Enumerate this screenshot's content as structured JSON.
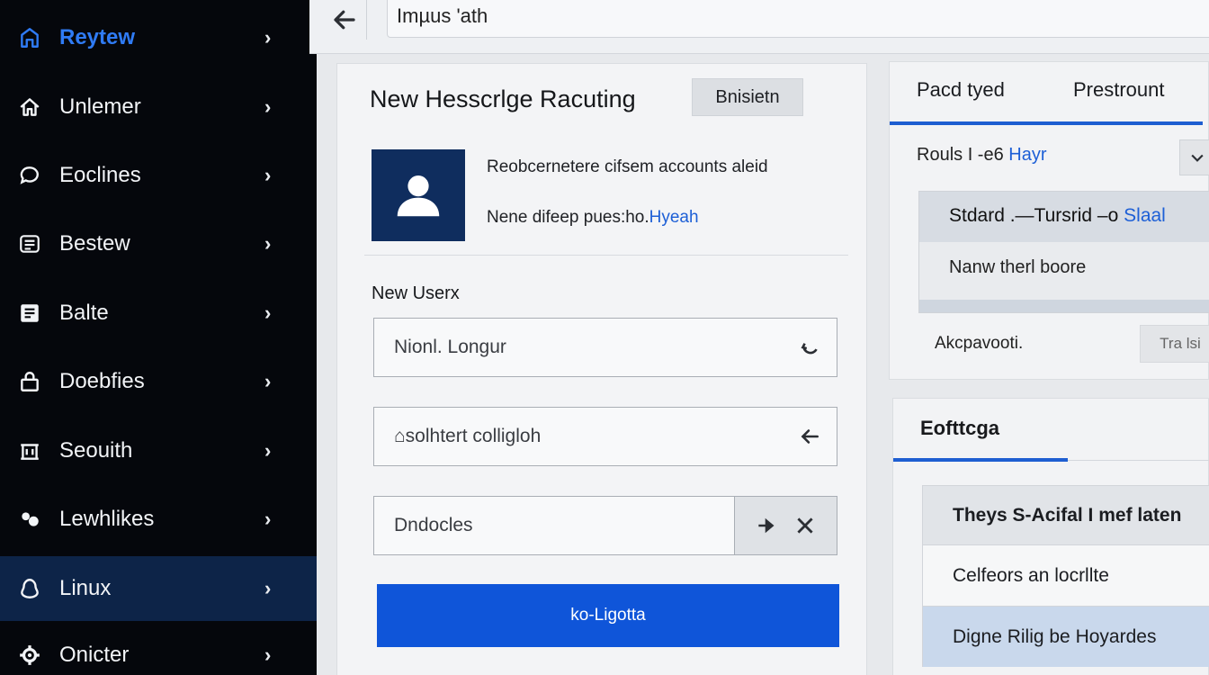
{
  "sidebar": {
    "items": [
      {
        "label": "Reytew",
        "icon": "home-outline-icon"
      },
      {
        "label": "Unlemer",
        "icon": "house-icon"
      },
      {
        "label": "Eoclines",
        "icon": "chat-bubble-icon"
      },
      {
        "label": "Bestew",
        "icon": "list-icon"
      },
      {
        "label": "Balte",
        "icon": "document-icon"
      },
      {
        "label": "Doebfies",
        "icon": "lock-icon"
      },
      {
        "label": "Seouith",
        "icon": "building-icon"
      },
      {
        "label": "Lewhlikes",
        "icon": "group-icon"
      },
      {
        "label": "Linux",
        "icon": "linux-icon"
      },
      {
        "label": "Onicter",
        "icon": "gear-icon"
      }
    ],
    "chevron": "›"
  },
  "topbar": {
    "address": "Imµus 'ath"
  },
  "card": {
    "title": "New Hesscrlge Racuting",
    "badge": "Bnisietn",
    "info_line1": "Reobcernetere cifsem accounts aleid",
    "info_line2_prefix": "Nene difeep pues:ho.",
    "info_line2_link": "Hyeah",
    "section_label": "New Userx",
    "field1_placeholder": "Nionl. Longur",
    "field2_placeholder": "⌂solhtert colligloh",
    "field3_placeholder": "Dndocles",
    "primary_button": "ko-Ligotta"
  },
  "right_top": {
    "tabs": [
      "Pacd tyed",
      "Prestrount"
    ],
    "row_prefix": "Rouls I -e6",
    "row_link": "Hayr",
    "box_header_prefix": "Stdard .—Tursrid –o",
    "box_header_link": "Slaal",
    "box_body": "Nanw therl boore",
    "footer_label": "Akcpavooti.",
    "footer_button": "Tra lsi"
  },
  "right_bottom": {
    "title": "Eofttcga",
    "rows": [
      "Theys S-Acifal I mef laten",
      "Celfeors an locrllte",
      "Digne Rilig be Hoyardes"
    ]
  },
  "colors": {
    "sidebar_bg": "#05070c",
    "accent": "#0f55d9",
    "sidebar_selected": "#0d2448",
    "avatar_bg": "#0f2d5e"
  }
}
